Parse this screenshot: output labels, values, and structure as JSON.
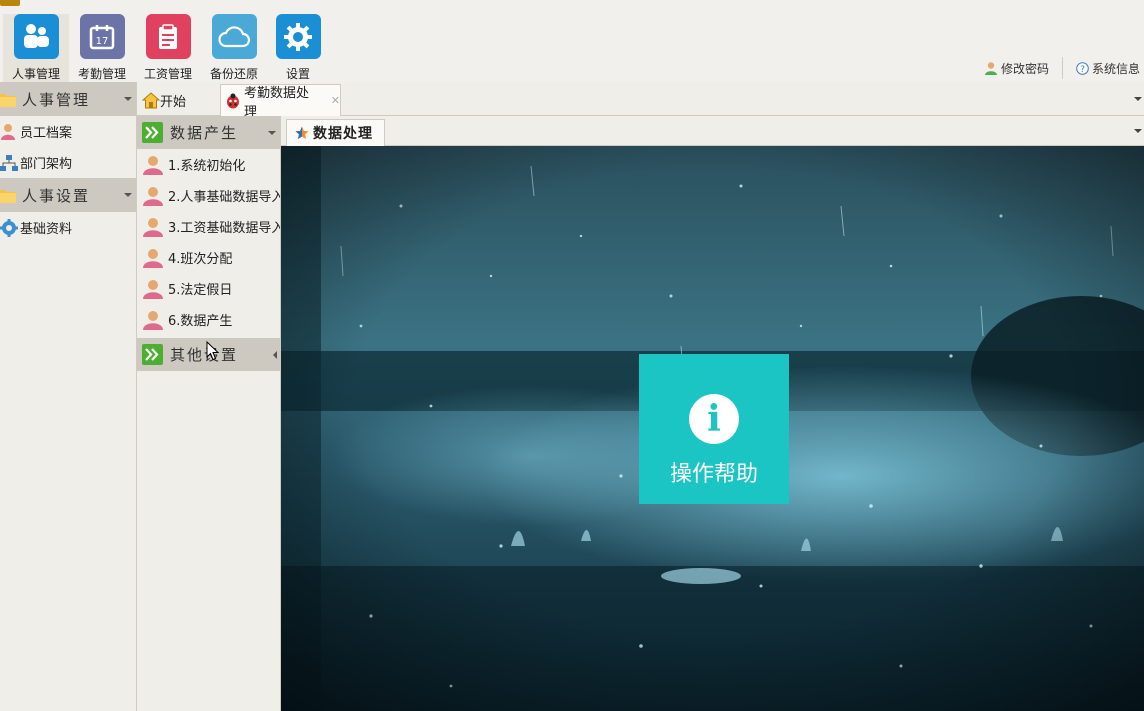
{
  "toolbar": {
    "buttons": [
      {
        "label": "人事管理",
        "color": "#1a8fd6"
      },
      {
        "label": "考勤管理",
        "color": "#6c73a6"
      },
      {
        "label": "工资管理",
        "color": "#e0415f"
      },
      {
        "label": "备份还原",
        "color": "#4aa9d6"
      },
      {
        "label": "设置",
        "color": "#1a8fd6"
      }
    ],
    "change_password": "修改密码",
    "system_info": "系统信息"
  },
  "sidebar": {
    "groups": [
      {
        "label": "人事管理",
        "items": [
          {
            "label": "员工档案",
            "icon": "user-icon"
          },
          {
            "label": "部门架构",
            "icon": "org-chart-icon"
          }
        ]
      },
      {
        "label": "人事设置",
        "items": [
          {
            "label": "基础资料",
            "icon": "gear-icon"
          }
        ]
      }
    ]
  },
  "tabs": {
    "home": "开始",
    "active": "考勤数据处理"
  },
  "subnav": {
    "group_data": "数据产生",
    "items": [
      "1.系统初始化",
      "2.人事基础数据导入",
      "3.工资基础数据导入",
      "4.班次分配",
      "5.法定假日",
      "6.数据产生"
    ],
    "group_other": "其他设置"
  },
  "inner_tab": "数据处理",
  "help_tile": "操作帮助"
}
